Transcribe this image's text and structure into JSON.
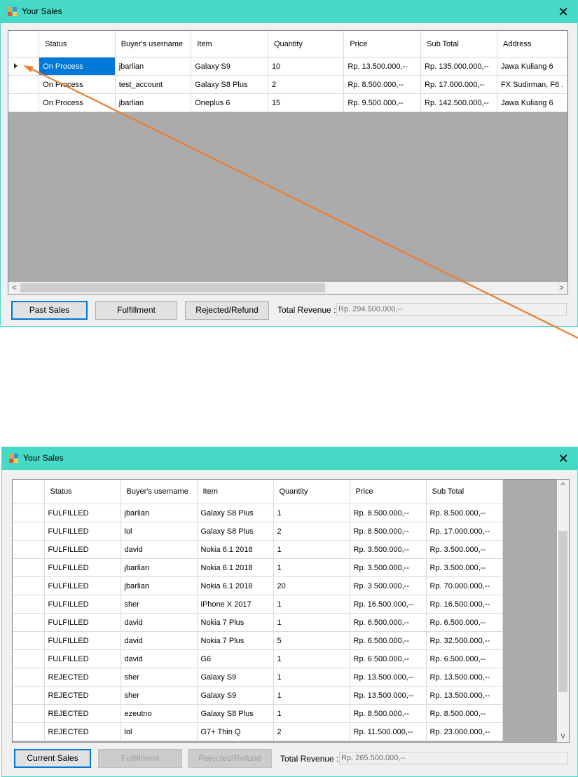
{
  "window1": {
    "title": "Your Sales",
    "close": "✕",
    "columns": [
      "Status",
      "Buyer's username",
      "Item",
      "Quantity",
      "Price",
      "Sub Total",
      "Address"
    ],
    "rows": [
      [
        "On Process",
        "jbarlian",
        "Galaxy S9",
        "10",
        "Rp. 13.500.000,--",
        "Rp. 135.000.000,--",
        "Jawa Kuliang 6"
      ],
      [
        "On Process",
        "test_account",
        "Galaxy S8 Plus",
        "2",
        "Rp. 8.500.000,--",
        "Rp. 17.000.000,--",
        "FX Sudirman, F6 ."
      ],
      [
        "On Process",
        "jbarlian",
        "Oneplus 6",
        "15",
        "Rp. 9.500.000,--",
        "Rp. 142.500.000,--",
        "Jawa Kuliang 6"
      ]
    ],
    "scroll_left": "<",
    "scroll_right": ">",
    "buttons": {
      "past_sales": "Past Sales",
      "fulfillment": "Fulfillment",
      "rejected_refund": "Rejected/Refund"
    },
    "total_revenue_label": "Total Revenue :",
    "total_revenue_value": "Rp. 294.500.000,--"
  },
  "window2": {
    "title": "Your Sales",
    "close": "✕",
    "columns": [
      "Status",
      "Buyer's username",
      "Item",
      "Quantity",
      "Price",
      "Sub Total"
    ],
    "rows": [
      [
        "FULFILLED",
        "jbarlian",
        "Galaxy S8 Plus",
        "1",
        "Rp. 8.500.000,--",
        "Rp. 8.500.000,--"
      ],
      [
        "FULFILLED",
        "lol",
        "Galaxy S8 Plus",
        "2",
        "Rp. 8.500.000,--",
        "Rp. 17.000.000,--"
      ],
      [
        "FULFILLED",
        "david",
        "Nokia 6.1 2018",
        "1",
        "Rp. 3.500.000,--",
        "Rp. 3.500.000,--"
      ],
      [
        "FULFILLED",
        "jbarlian",
        "Nokia 6.1 2018",
        "1",
        "Rp. 3.500.000,--",
        "Rp. 3.500.000,--"
      ],
      [
        "FULFILLED",
        "jbarlian",
        "Nokia 6.1 2018",
        "20",
        "Rp. 3.500.000,--",
        "Rp. 70.000.000,--"
      ],
      [
        "FULFILLED",
        "sher",
        "iPhone X 2017",
        "1",
        "Rp. 16.500.000,--",
        "Rp. 16.500.000,--"
      ],
      [
        "FULFILLED",
        "david",
        "Nokia 7 Plus",
        "1",
        "Rp. 6.500.000,--",
        "Rp. 6.500.000,--"
      ],
      [
        "FULFILLED",
        "david",
        "Nokia 7 Plus",
        "5",
        "Rp. 6.500.000,--",
        "Rp. 32.500.000,--"
      ],
      [
        "FULFILLED",
        "david",
        "G6",
        "1",
        "Rp. 6.500.000,--",
        "Rp. 6.500.000,--"
      ],
      [
        "REJECTED",
        "sher",
        "Galaxy S9",
        "1",
        "Rp. 13.500.000,--",
        "Rp. 13.500.000,--"
      ],
      [
        "REJECTED",
        "sher",
        "Galaxy S9",
        "1",
        "Rp. 13.500.000,--",
        "Rp. 13.500.000,--"
      ],
      [
        "REJECTED",
        "ezeutno",
        "Galaxy S8 Plus",
        "1",
        "Rp. 8.500.000,--",
        "Rp. 8.500.000,--"
      ],
      [
        "REJECTED",
        "lol",
        "G7+ Thin Q",
        "2",
        "Rp. 11.500.000,--",
        "Rp. 23.000.000,--"
      ]
    ],
    "scroll_up": "^",
    "scroll_down": "v",
    "buttons": {
      "current_sales": "Current Sales",
      "fulfillment": "Fulfillment",
      "rejected_refund": "Rejected/Refund"
    },
    "total_revenue_label": "Total Revenue :",
    "total_revenue_value": "Rp. 265.500.000,--"
  },
  "colors": {
    "titlebar": "#46d9c6",
    "selection": "#0078d7",
    "annotation_arrow": "#ed7d31"
  }
}
